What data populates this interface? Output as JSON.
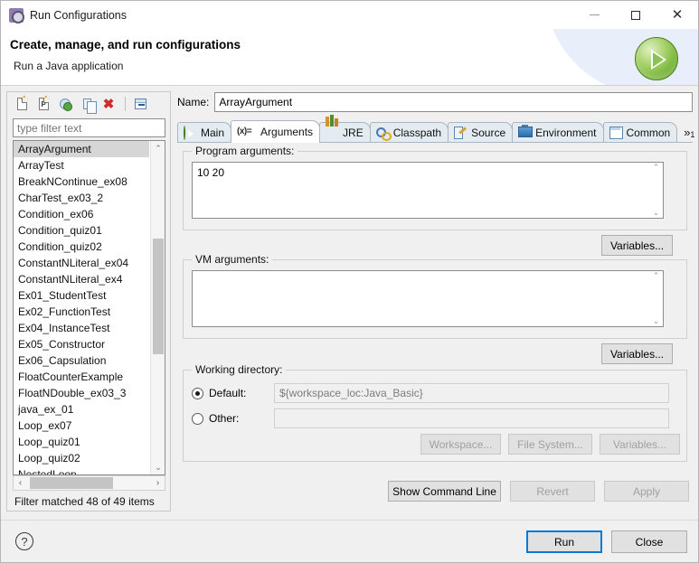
{
  "window": {
    "title": "Run Configurations",
    "icon": "run-configurations-icon",
    "minimize_label": "—",
    "maximize_label": "☐",
    "close_label": "✕"
  },
  "header": {
    "title": "Create, manage, and run configurations",
    "subtitle": "Run a Java application",
    "badge_icon": "run-play-icon"
  },
  "left_panel": {
    "toolbar": [
      {
        "name": "new-configuration-icon",
        "tooltip": "New launch configuration"
      },
      {
        "name": "new-prototype-icon",
        "tooltip": "New prototype",
        "letter": "P"
      },
      {
        "name": "export-configuration-icon",
        "tooltip": "Export"
      },
      {
        "name": "duplicate-configuration-icon",
        "tooltip": "Duplicate"
      },
      {
        "name": "delete-configuration-icon",
        "tooltip": "Delete",
        "glyph": "✖"
      },
      {
        "name": "collapse-all-icon",
        "tooltip": "Collapse All"
      }
    ],
    "filter": {
      "value": "",
      "placeholder": "type filter text"
    },
    "items": [
      "ArrayArgument",
      "ArrayTest",
      "BreakNContinue_ex08",
      "CharTest_ex03_2",
      "Condition_ex06",
      "Condition_quiz01",
      "Condition_quiz02",
      "ConstantNLiteral_ex04",
      "ConstantNLiteral_ex4",
      "Ex01_StudentTest",
      "Ex02_FunctionTest",
      "Ex04_InstanceTest",
      "Ex05_Constructor",
      "Ex06_Capsulation",
      "FloatCounterExample",
      "FloatNDouble_ex03_3",
      "java_ex_01",
      "Loop_ex07",
      "Loop_quiz01",
      "Loop_quiz02",
      "NestedLoop"
    ],
    "selected_item": "ArrayArgument",
    "scroll_up_glyph": "⌃",
    "scroll_down_glyph": "⌄",
    "scroll_left_glyph": "‹",
    "scroll_right_glyph": "›",
    "status": "Filter matched 48 of 49 items"
  },
  "right_panel": {
    "name_label": "Name:",
    "name_value": "ArrayArgument",
    "tabs": [
      {
        "label": "Main",
        "icon": "main-tab-icon",
        "active": false
      },
      {
        "label": "Arguments",
        "icon": "arguments-tab-icon",
        "icon_text": "(x)=",
        "active": true
      },
      {
        "label": "JRE",
        "icon": "jre-tab-icon",
        "active": false
      },
      {
        "label": "Classpath",
        "icon": "classpath-tab-icon",
        "active": false
      },
      {
        "label": "Source",
        "icon": "source-tab-icon",
        "active": false
      },
      {
        "label": "Environment",
        "icon": "environment-tab-icon",
        "active": false
      },
      {
        "label": "Common",
        "icon": "common-tab-icon",
        "active": false
      }
    ],
    "tab_overflow": "»",
    "tab_overflow_count": "1",
    "program_arguments": {
      "group_label": "Program arguments:",
      "value": "10 20",
      "variables_button": "Variables..."
    },
    "vm_arguments": {
      "group_label": "VM arguments:",
      "value": "",
      "variables_button": "Variables..."
    },
    "working_directory": {
      "group_label": "Working directory:",
      "default_label": "Default:",
      "default_value": "${workspace_loc:Java_Basic}",
      "default_selected": true,
      "other_label": "Other:",
      "other_value": "",
      "other_selected": false,
      "workspace_button": "Workspace...",
      "file_system_button": "File System...",
      "variables_button": "Variables..."
    },
    "actions": {
      "show_command_line": "Show Command Line",
      "revert": "Revert",
      "apply": "Apply"
    }
  },
  "footer": {
    "help_glyph": "?",
    "run_button": "Run",
    "close_button": "Close"
  },
  "colors": {
    "accent": "#0078d7",
    "run_green": "#6fb030",
    "delete_red": "#d22b2b",
    "dialog_bg": "#f0f0f0",
    "selection": "#d6d6d6"
  }
}
